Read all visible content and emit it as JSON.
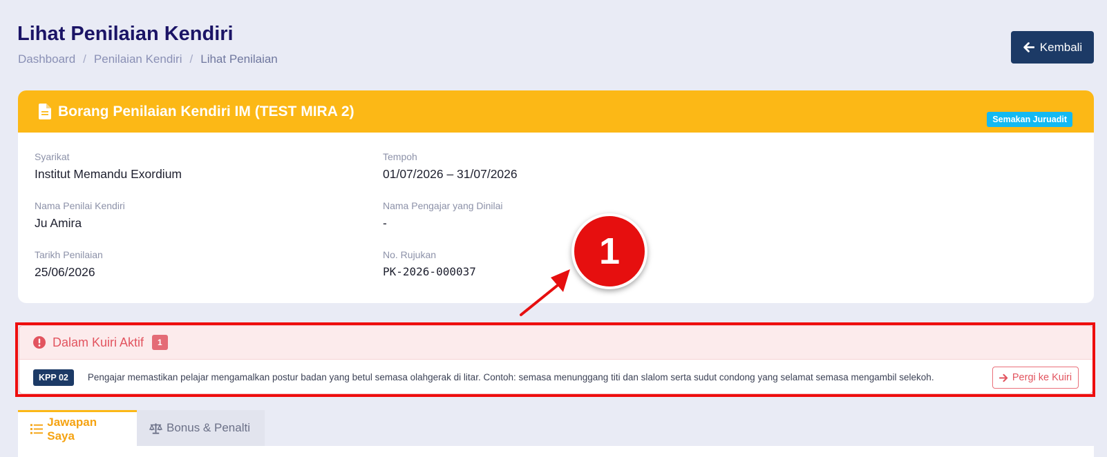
{
  "header": {
    "title": "Lihat Penilaian Kendiri",
    "back_label": "Kembali"
  },
  "breadcrumb": {
    "items": [
      "Dashboard",
      "Penilaian Kendiri",
      "Lihat Penilaian"
    ],
    "separator": "/"
  },
  "card": {
    "title": "Borang Penilaian Kendiri IM (TEST MIRA 2)",
    "status_badge": "Semakan Juruadit",
    "fields": {
      "syarikat": {
        "label": "Syarikat",
        "value": "Institut Memandu Exordium"
      },
      "tempoh": {
        "label": "Tempoh",
        "value": "01/07/2026 – 31/07/2026"
      },
      "penilai": {
        "label": "Nama Penilai Kendiri",
        "value": "Ju Amira"
      },
      "pengajar": {
        "label": "Nama Pengajar yang Dinilai",
        "value": "-"
      },
      "tarikh": {
        "label": "Tarikh Penilaian",
        "value": "25/06/2026"
      },
      "rujukan": {
        "label": "No. Rujukan",
        "value": "PK-2026-000037"
      }
    }
  },
  "annotation": {
    "number": "1"
  },
  "query": {
    "title": "Dalam Kuiri Aktif",
    "count": "1",
    "items": [
      {
        "code": "KPP 02",
        "text": "Pengajar memastikan pelajar mengamalkan postur badan yang betul semasa olahgerak di litar. Contoh: semasa menunggang titi dan slalom serta sudut condong yang selamat semasa mengambil selekoh.",
        "action_label": "Pergi ke Kuiri"
      }
    ]
  },
  "tabs": [
    {
      "label": "Jawapan Saya",
      "icon": "list-icon",
      "active": true
    },
    {
      "label": "Bonus & Penalti",
      "icon": "balance-scale-icon",
      "active": false
    }
  ],
  "colors": {
    "primary": "#1c3a66",
    "header_yellow": "#fcb816",
    "info": "#13b9f2",
    "danger": "#e2545f",
    "annotation_red": "#e60f0f"
  }
}
